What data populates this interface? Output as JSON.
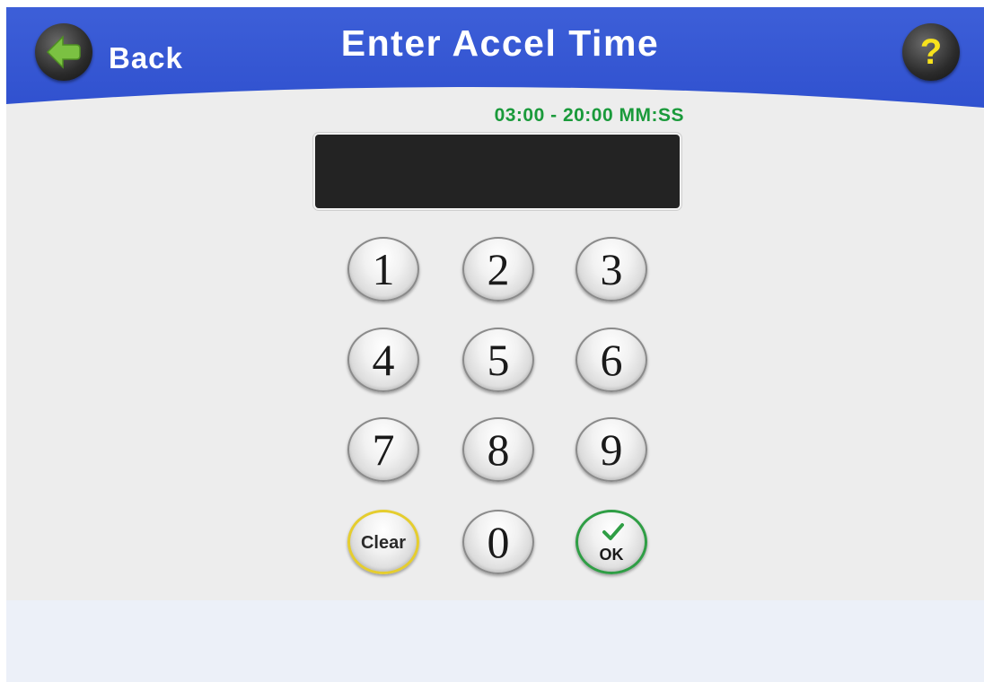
{
  "header": {
    "back_label": "Back",
    "back_icon": "arrow-left-icon",
    "title": "Enter Accel Time",
    "help_label": "?",
    "help_icon": "help-icon",
    "accent_color": "#3557d3"
  },
  "entry": {
    "range_label": "03:00 - 20:00 MM:SS",
    "value": "",
    "range_color": "#1a9a3b"
  },
  "keypad": {
    "keys": [
      "1",
      "2",
      "3",
      "4",
      "5",
      "6",
      "7",
      "8",
      "9"
    ],
    "clear_label": "Clear",
    "zero_label": "0",
    "ok_label": "OK",
    "ok_icon": "checkmark-icon"
  }
}
